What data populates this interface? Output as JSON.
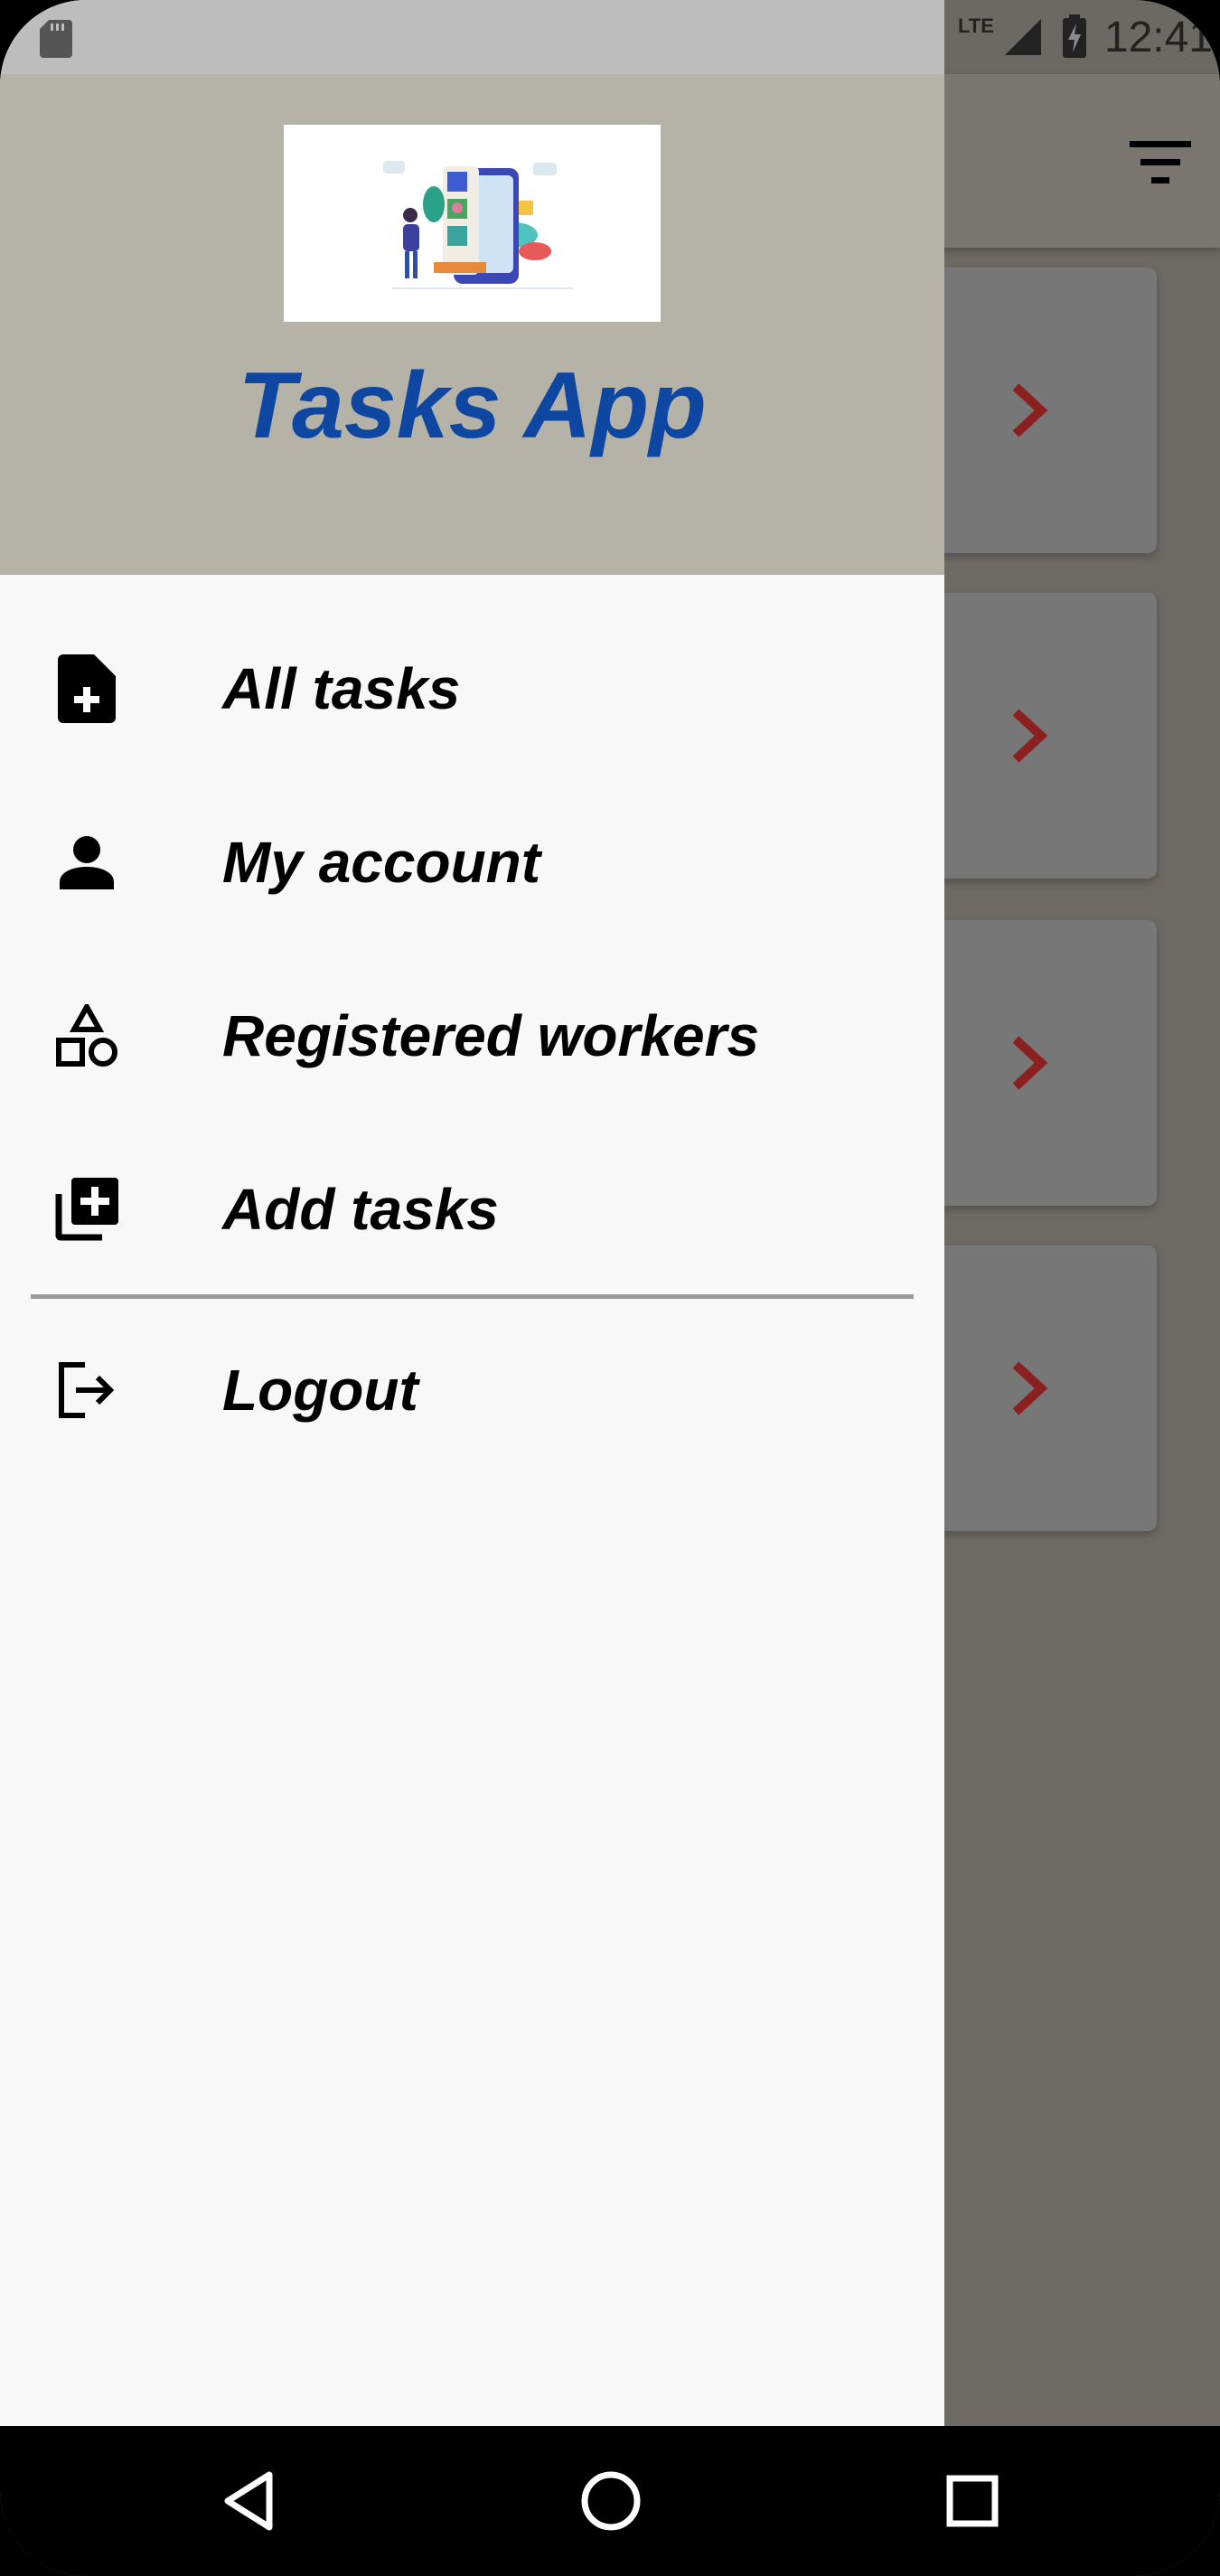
{
  "status_bar": {
    "time": "12:41",
    "network": "LTE"
  },
  "drawer": {
    "title": "Tasks App",
    "items": [
      {
        "label": "All tasks",
        "icon": "note-add-icon"
      },
      {
        "label": "My account",
        "icon": "person-icon"
      },
      {
        "label": "Registered workers",
        "icon": "category-shapes-icon"
      },
      {
        "label": "Add tasks",
        "icon": "library-add-icon"
      }
    ],
    "logout": {
      "label": "Logout",
      "icon": "logout-icon"
    }
  },
  "background": {
    "task_card_count": 4
  },
  "colors": {
    "title": "#0d47a1",
    "header_bg": "#b5b2a7",
    "chevron": "#8b2020"
  }
}
